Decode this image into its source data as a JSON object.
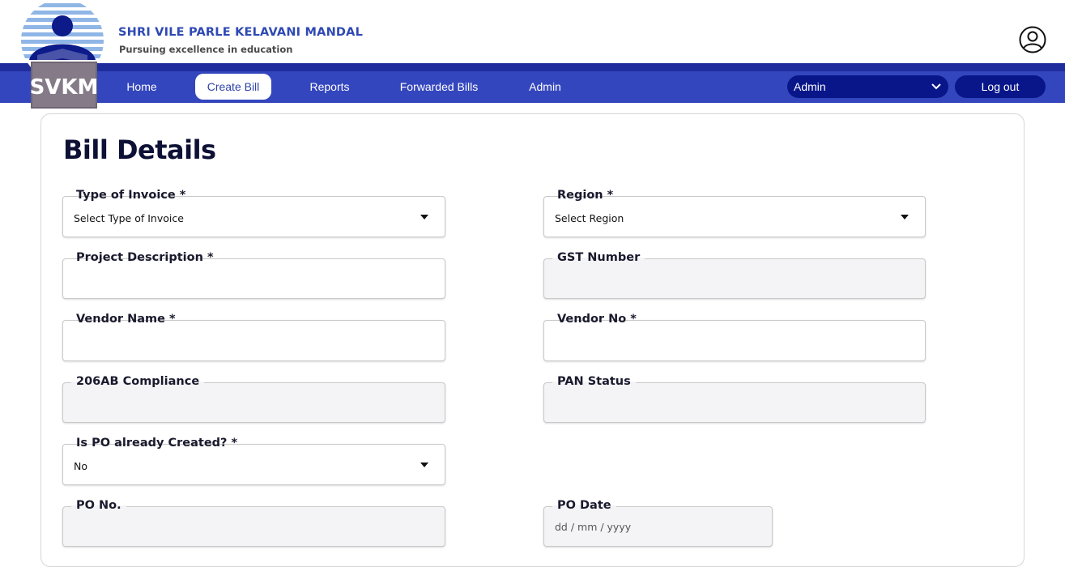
{
  "header": {
    "org_title": "SHRI VILE PARLE KELAVANI MANDAL",
    "tagline": "Pursuing excellence in education",
    "logo_text": "SVKM"
  },
  "nav": {
    "items": [
      {
        "label": "Home"
      },
      {
        "label": "Create Bill"
      },
      {
        "label": "Reports"
      },
      {
        "label": "Forwarded Bills"
      },
      {
        "label": "Admin"
      }
    ],
    "role_selected": "Admin",
    "logout_label": "Log out"
  },
  "colors": {
    "brand_blue": "#3446bd",
    "dark_blue": "#08168a",
    "title_blue": "#2e49b3"
  },
  "icons": [
    "user-icon",
    "chevron-down-icon",
    "caret-down-icon"
  ],
  "form": {
    "title": "Bill Details",
    "fields": {
      "type_of_invoice": {
        "label": "Type of Invoice *",
        "value": "Select Type of Invoice"
      },
      "region": {
        "label": "Region *",
        "value": "Select Region"
      },
      "project_description": {
        "label": "Project Description *",
        "value": ""
      },
      "gst_number": {
        "label": "GST Number",
        "value": ""
      },
      "vendor_name": {
        "label": "Vendor Name *",
        "value": ""
      },
      "vendor_no": {
        "label": "Vendor No *",
        "value": ""
      },
      "compliance_206ab": {
        "label": "206AB Compliance",
        "value": ""
      },
      "pan_status": {
        "label": "PAN Status",
        "value": ""
      },
      "po_created": {
        "label": "Is PO already Created? *",
        "value": "No"
      },
      "po_no": {
        "label": "PO No.",
        "value": ""
      },
      "po_date": {
        "label": "PO Date",
        "value": "dd / mm / yyyy"
      }
    }
  }
}
